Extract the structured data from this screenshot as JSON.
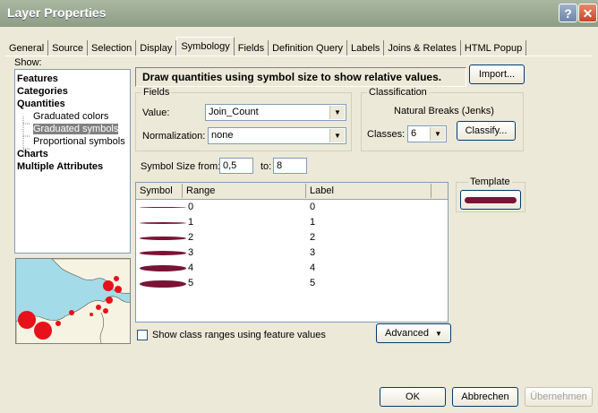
{
  "window": {
    "title": "Layer Properties",
    "help": "?",
    "close": "✕"
  },
  "tabs": [
    "General",
    "Source",
    "Selection",
    "Display",
    "Symbology",
    "Fields",
    "Definition Query",
    "Labels",
    "Joins & Relates",
    "HTML Popup"
  ],
  "active_tab": "Symbology",
  "show": {
    "label": "Show:",
    "items": [
      {
        "label": "Features",
        "bold": true
      },
      {
        "label": "Categories",
        "bold": true
      },
      {
        "label": "Quantities",
        "bold": true
      },
      {
        "label": "Graduated colors",
        "sub": true
      },
      {
        "label": "Graduated symbols",
        "sub": true,
        "selected": true
      },
      {
        "label": "Proportional symbols",
        "sub": true
      },
      {
        "label": "Charts",
        "bold": true
      },
      {
        "label": "Multiple Attributes",
        "bold": true
      }
    ]
  },
  "description": "Draw quantities using symbol size to show relative values.",
  "import_button": "Import...",
  "fields": {
    "group_label": "Fields",
    "value_label": "Value:",
    "value": "Join_Count",
    "normalization_label": "Normalization:",
    "normalization": "none"
  },
  "classification": {
    "group_label": "Classification",
    "method": "Natural Breaks (Jenks)",
    "classes_label": "Classes:",
    "classes": "6",
    "classify_button": "Classify..."
  },
  "symbol_size": {
    "from_label": "Symbol Size from:",
    "from": "0,5",
    "to_label": "to:",
    "to": "8"
  },
  "table": {
    "headers": {
      "symbol": "Symbol",
      "range": "Range",
      "label": "Label"
    },
    "rows": [
      {
        "range": "0",
        "label": "0",
        "size": 0.5
      },
      {
        "range": "1",
        "label": "1",
        "size": 2.0
      },
      {
        "range": "2",
        "label": "2",
        "size": 3.5
      },
      {
        "range": "3",
        "label": "3",
        "size": 5.0
      },
      {
        "range": "4",
        "label": "4",
        "size": 6.5
      },
      {
        "range": "5",
        "label": "5",
        "size": 8.0
      }
    ]
  },
  "template": {
    "label": "Template"
  },
  "show_class_ranges": {
    "label": "Show class ranges using feature values",
    "checked": false
  },
  "advanced_button": "Advanced",
  "footer": {
    "ok": "OK",
    "cancel": "Abbrechen",
    "apply": "Übernehmen"
  },
  "colors": {
    "symbol": "#7a1336",
    "preview_dots": "#e8101a",
    "water": "#a4dbe8",
    "land": "#f6f3e2"
  }
}
